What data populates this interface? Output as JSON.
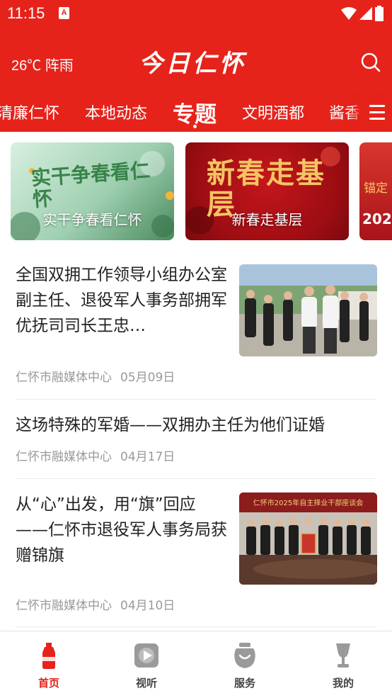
{
  "statusbar": {
    "time": "11:15",
    "sim_label": "A"
  },
  "header": {
    "weather": "26℃ 阵雨",
    "logo": "今日仁怀",
    "brand_color": "#e5231b"
  },
  "nav": {
    "items": [
      "清廉仁怀",
      "本地动态",
      "专题",
      "文明酒都",
      "酱香"
    ],
    "active": "专题"
  },
  "topics": [
    {
      "title_art": "实干争春看仁怀",
      "label": "实干争春看仁怀"
    },
    {
      "title_art": "新春走基层",
      "label": "新春走基层"
    },
    {
      "title_art": "锚定",
      "label": "202"
    }
  ],
  "news": [
    {
      "title": "全国双拥工作领导小组办公室副主任、退役军人事务部拥军优抚司司长王忠…",
      "source": "仁怀市融媒体中心",
      "date": "05月09日",
      "has_image": true
    },
    {
      "title": "这场特殊的军婚——双拥办主任为他们证婚",
      "source": "仁怀市融媒体中心",
      "date": "04月17日",
      "has_image": false
    },
    {
      "title": "从“心”出发，用“旗”回应——仁怀市退役军人事务局获赠锦旗",
      "source": "仁怀市融媒体中心",
      "date": "04月10日",
      "has_image": true,
      "image_banner": "仁怀市2025年自主择业干部座谈会"
    }
  ],
  "tabbar": {
    "tabs": [
      {
        "label": "首页",
        "icon": "bottle-icon",
        "active": true
      },
      {
        "label": "视听",
        "icon": "play-icon",
        "active": false
      },
      {
        "label": "服务",
        "icon": "jar-icon",
        "active": false
      },
      {
        "label": "我的",
        "icon": "cup-icon",
        "active": false
      }
    ]
  }
}
